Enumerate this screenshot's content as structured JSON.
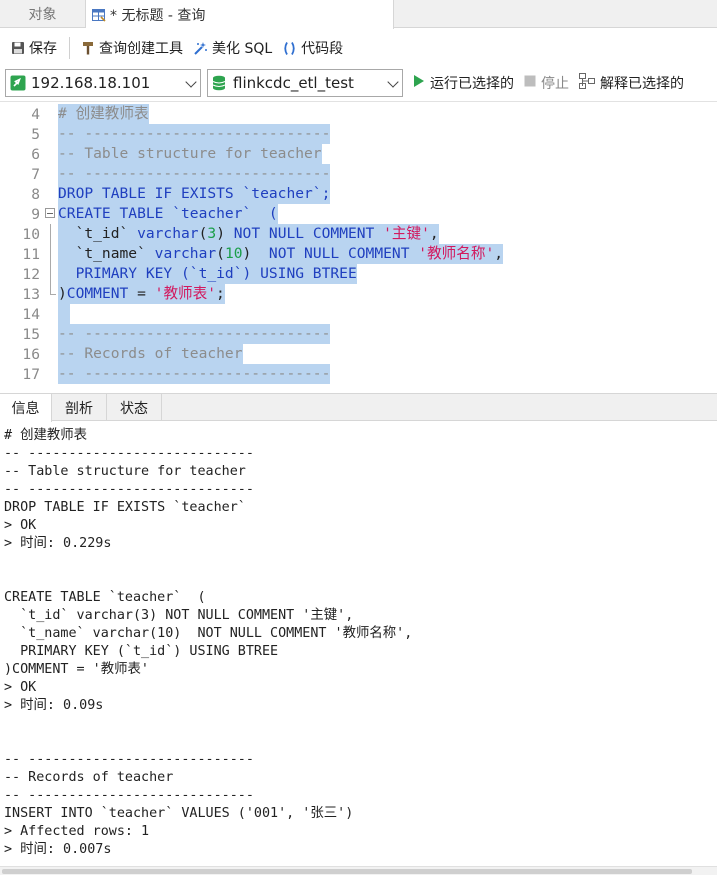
{
  "tabs": {
    "objects": "对象",
    "query": "* 无标题 - 查询"
  },
  "toolbar": {
    "save": "保存",
    "query_builder": "查询创建工具",
    "beautify": "美化 SQL",
    "snippet": "代码段"
  },
  "connection": {
    "host": "192.168.18.101",
    "database": "flinkcdc_etl_test",
    "run_selected": "运行已选择的",
    "stop": "停止",
    "explain_selected": "解释已选择的"
  },
  "editor": {
    "line_numbers": [
      "4",
      "5",
      "6",
      "7",
      "8",
      "9",
      "10",
      "11",
      "12",
      "13",
      "14",
      "15",
      "16",
      "17"
    ],
    "lines": [
      "# 创建教师表",
      "-- ----------------------------",
      "-- Table structure for teacher",
      "-- ----------------------------",
      "DROP TABLE IF EXISTS `teacher`;",
      "CREATE TABLE `teacher`  (",
      "  `t_id` varchar(3) NOT NULL COMMENT '主键',",
      "  `t_name` varchar(10)  NOT NULL COMMENT '教师名称',",
      "  PRIMARY KEY (`t_id`) USING BTREE",
      ")COMMENT = '教师表';",
      "",
      "-- ----------------------------",
      "-- Records of teacher",
      "-- ----------------------------"
    ]
  },
  "bottom_tabs": {
    "info": "信息",
    "profile": "剖析",
    "status": "状态"
  },
  "output_lines": [
    "# 创建教师表",
    "-- ----------------------------",
    "-- Table structure for teacher",
    "-- ----------------------------",
    "DROP TABLE IF EXISTS `teacher`",
    "> OK",
    "> 时间: 0.229s",
    "",
    "",
    "CREATE TABLE `teacher`  (",
    "  `t_id` varchar(3) NOT NULL COMMENT '主键',",
    "  `t_name` varchar(10)  NOT NULL COMMENT '教师名称',",
    "  PRIMARY KEY (`t_id`) USING BTREE",
    ")COMMENT = '教师表'",
    "> OK",
    "> 时间: 0.09s",
    "",
    "",
    "-- ----------------------------",
    "-- Records of teacher",
    "-- ----------------------------",
    "INSERT INTO `teacher` VALUES ('001', '张三')",
    "> Affected rows: 1",
    "> 时间: 0.007s"
  ],
  "colors": {
    "selection": "#b9d4f0",
    "keyword": "#1f3fbf",
    "string": "#d2195e",
    "number": "#1a9e48",
    "comment": "#8c8c8c",
    "run_green": "#2ea44f"
  }
}
